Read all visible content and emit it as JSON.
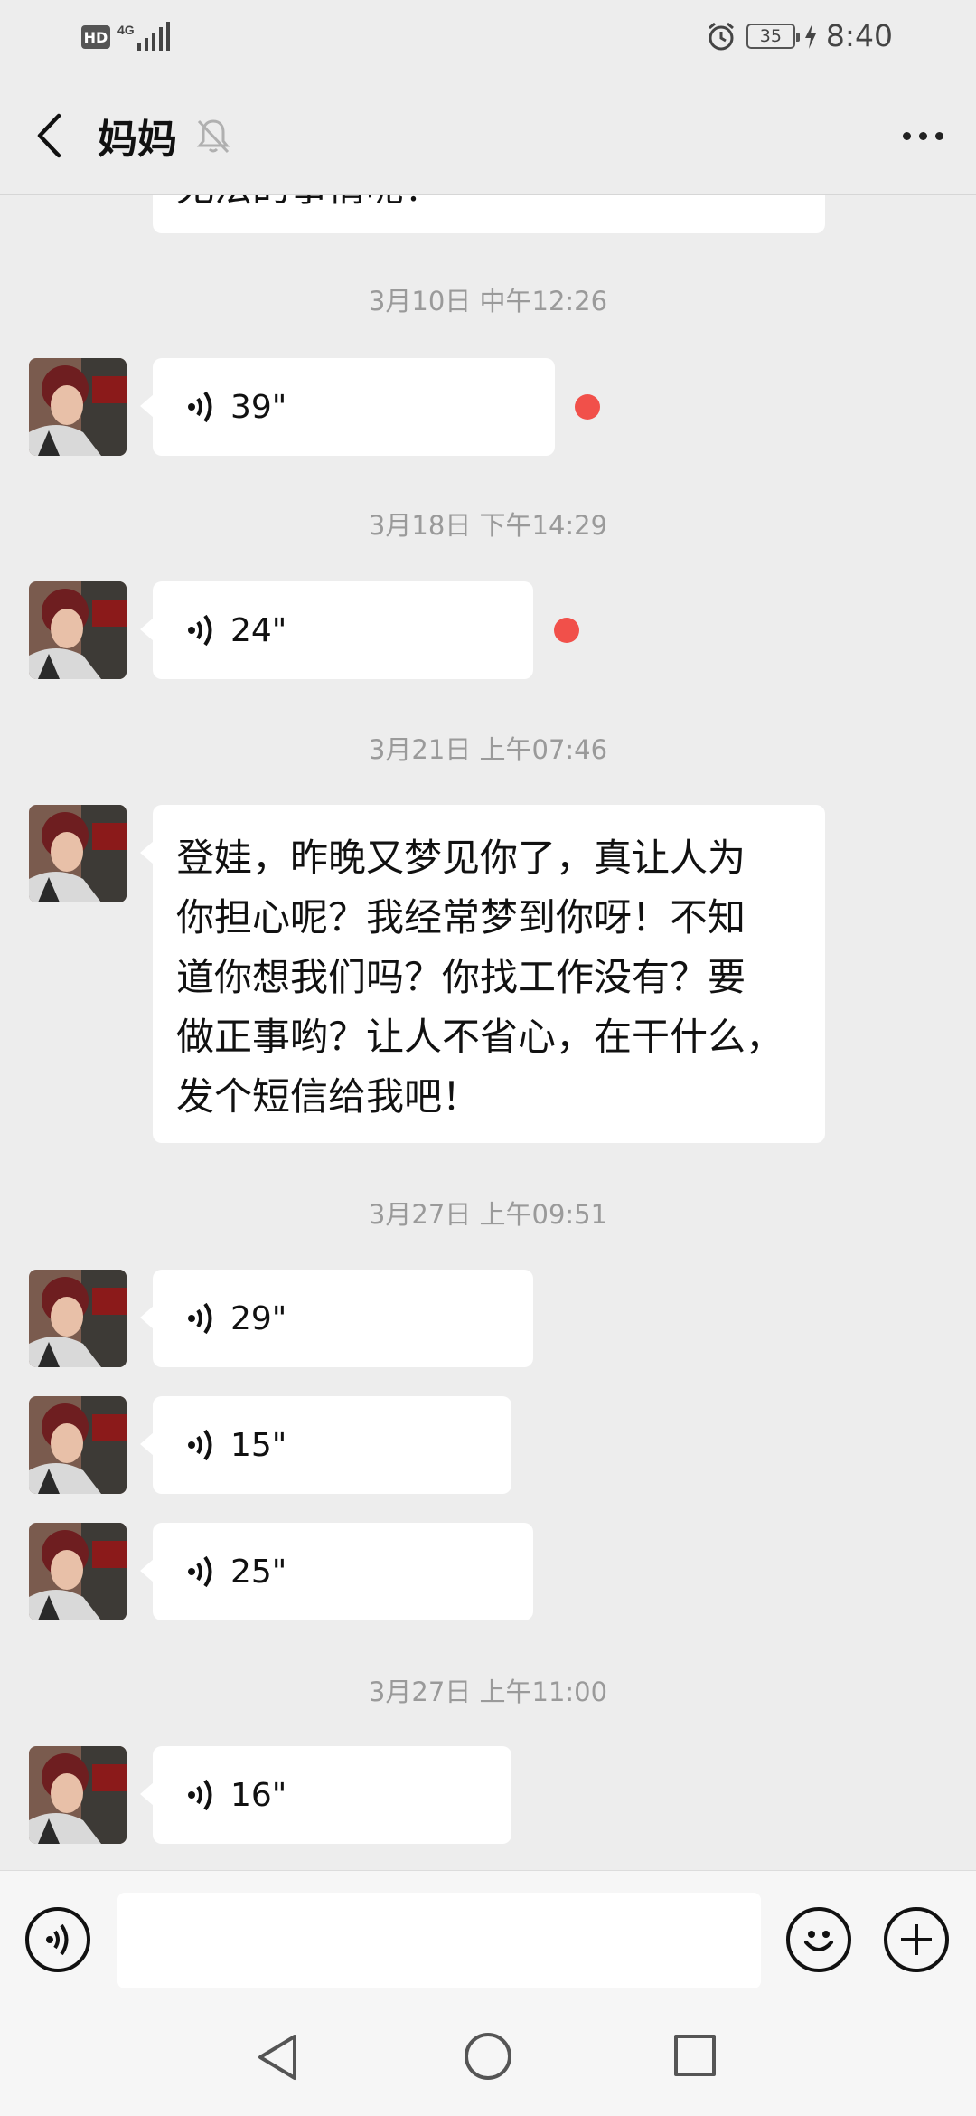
{
  "status_bar": {
    "hd_label": "HD",
    "network_label": "4G",
    "battery_level": "35",
    "time": "8:40"
  },
  "header": {
    "title": "妈妈"
  },
  "partial_message": {
    "text": "无法的事情呢！"
  },
  "messages": [
    {
      "timestamp": "3月10日 中午12:26",
      "type": "voice",
      "duration": "39\"",
      "unread": true
    },
    {
      "timestamp": "3月18日 下午14:29",
      "type": "voice",
      "duration": "24\"",
      "unread": true
    },
    {
      "timestamp": "3月21日 上午07:46",
      "type": "text",
      "lines": [
        "登娃，昨晚又梦见你了，真让人为",
        "你担心呢？我经常梦到你呀！不知",
        "道你想我们吗？你找工作没有？要",
        "做正事哟？让人不省心，在干什么，",
        "发个短信给我吧！"
      ]
    },
    {
      "timestamp": "3月27日 上午09:51",
      "type": "voice",
      "duration": "29\""
    },
    {
      "type": "voice",
      "duration": "15\""
    },
    {
      "type": "voice",
      "duration": "25\""
    },
    {
      "timestamp": "3月27日 上午11:00",
      "type": "voice",
      "duration": "16\""
    }
  ],
  "input_bar": {
    "input_value": "",
    "icons": [
      "voice-toggle-icon",
      "emoji-icon",
      "plus-icon"
    ]
  },
  "nav_bar": {
    "icons": [
      "nav-back-icon",
      "nav-home-icon",
      "nav-recents-icon"
    ]
  }
}
